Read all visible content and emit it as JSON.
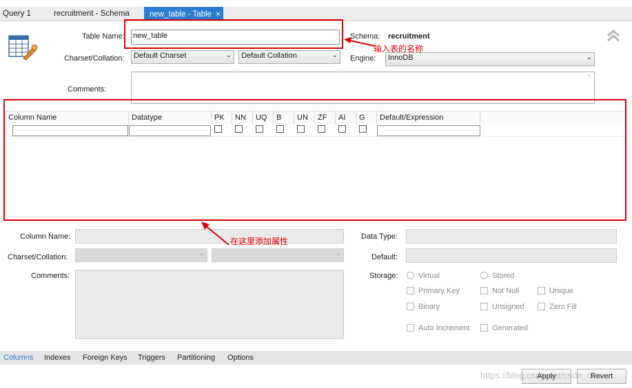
{
  "tabs": [
    {
      "label": "Query 1"
    },
    {
      "label": "recruitment - Schema"
    },
    {
      "label": "new_table - Table",
      "close": "×"
    }
  ],
  "form": {
    "table_name_label": "Table Name:",
    "table_name_value": "new_table",
    "schema_label": "Schema:",
    "schema_value": "recruitment",
    "charset_label": "Charset/Collation:",
    "charset_value": "Default Charset",
    "collation_value": "Default Collation",
    "engine_label": "Engine:",
    "engine_value": "InnoDB",
    "comments_label": "Comments:"
  },
  "grid": {
    "headers": [
      "Column Name",
      "Datatype",
      "PK",
      "NN",
      "UQ",
      "B",
      "UN",
      "ZF",
      "AI",
      "G",
      "Default/Expression"
    ]
  },
  "details": {
    "column_name_label": "Column Name:",
    "charset_label": "Charset/Collation:",
    "comments_label": "Comments:",
    "data_type_label": "Data Type:",
    "default_label": "Default:",
    "storage_label": "Storage:",
    "virtual": "Virtual",
    "stored": "Stored",
    "primary_key": "Primary Key",
    "not_null": "Not Null",
    "unique": "Unique",
    "binary": "Binary",
    "unsigned": "Unsigned",
    "zero_fill": "Zero Fill",
    "auto_increment": "Auto Increment",
    "generated": "Generated"
  },
  "bottom_tabs": [
    "Columns",
    "Indexes",
    "Foreign Keys",
    "Triggers",
    "Partitioning",
    "Options"
  ],
  "buttons": {
    "apply": "Apply",
    "revert": "Revert"
  },
  "annotations": {
    "name_hint": "输入表的名称",
    "attr_hint": "在这里添加属性"
  },
  "watermark": "https://blog.csdn.net/csdn_chu...",
  "colors": {
    "accent": "#2a7dd1",
    "annotation": "#e00000"
  }
}
